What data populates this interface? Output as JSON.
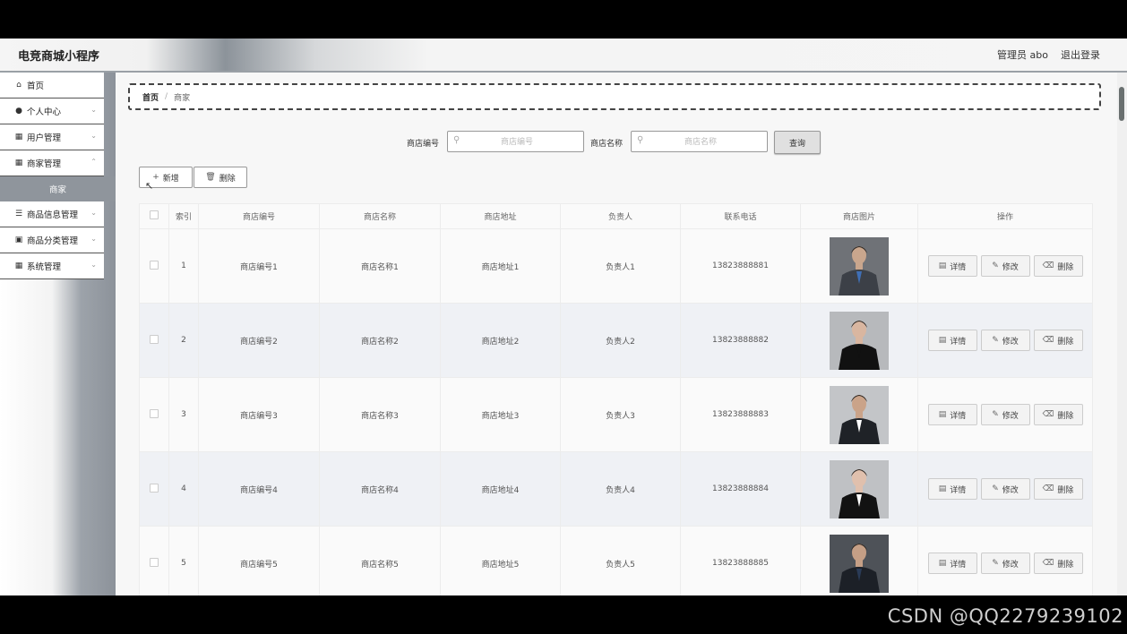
{
  "app": {
    "brand": "电竞商城小程序",
    "user": "管理员 abo",
    "logout": "退出登录"
  },
  "sidebar": {
    "items": [
      {
        "icon": "home-icon",
        "label": "首页",
        "chevron": false
      },
      {
        "icon": "user-icon",
        "label": "个人中心",
        "chevron": true
      },
      {
        "icon": "grid-icon",
        "label": "用户管理",
        "chevron": true
      },
      {
        "icon": "grid-icon",
        "label": "商家管理",
        "chevron": true
      },
      {
        "icon": "list-icon",
        "label": "商品信息管理",
        "chevron": true
      },
      {
        "icon": "box-icon",
        "label": "商品分类管理",
        "chevron": true
      },
      {
        "icon": "grid-icon",
        "label": "系统管理",
        "chevron": true
      }
    ],
    "active_sub": "商家"
  },
  "breadcrumb": {
    "home": "首页",
    "sep": "/",
    "current": "商家"
  },
  "search": {
    "field1_label": "商店编号",
    "field1_placeholder": "商店编号",
    "field2_label": "商店名称",
    "field2_placeholder": "商店名称",
    "query_label": "查询"
  },
  "actions": {
    "add_label": "新增",
    "delete_label": "删除"
  },
  "table": {
    "headers": [
      "索引",
      "商店编号",
      "商店名称",
      "商店地址",
      "负责人",
      "联系电话",
      "商店图片",
      "操作"
    ],
    "rows": [
      {
        "index": "1",
        "code": "商店编号1",
        "name": "商店名称1",
        "address": "商店地址1",
        "manager": "负责人1",
        "phone": "13823888881"
      },
      {
        "index": "2",
        "code": "商店编号2",
        "name": "商店名称2",
        "address": "商店地址2",
        "manager": "负责人2",
        "phone": "13823888882"
      },
      {
        "index": "3",
        "code": "商店编号3",
        "name": "商店名称3",
        "address": "商店地址3",
        "manager": "负责人3",
        "phone": "13823888883"
      },
      {
        "index": "4",
        "code": "商店编号4",
        "name": "商店名称4",
        "address": "商店地址4",
        "manager": "负责人4",
        "phone": "13823888884"
      },
      {
        "index": "5",
        "code": "商店编号5",
        "name": "商店名称5",
        "address": "商店地址5",
        "manager": "负责人5",
        "phone": "13823888885"
      }
    ],
    "row_actions": {
      "detail": "详情",
      "edit": "修改",
      "delete": "删除"
    }
  },
  "watermark": "CSDN @QQ2279239102"
}
